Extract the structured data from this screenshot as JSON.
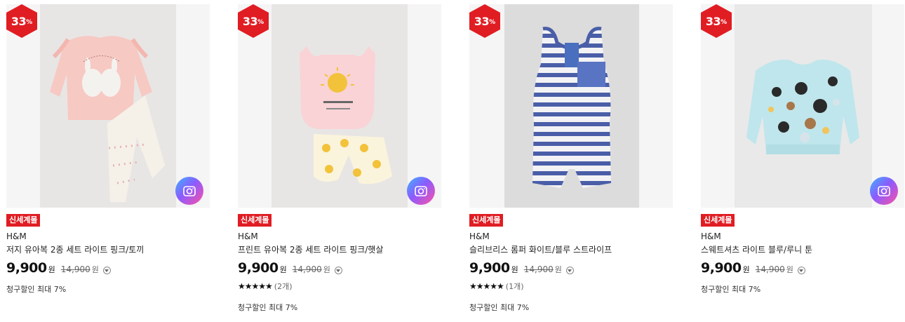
{
  "products": [
    {
      "discount": "33",
      "discount_unit": "%",
      "tag": "신세계몰",
      "brand": "H&M",
      "name": "저지 유아복 2종 세트 라이트 핑크/토끼",
      "price": "9,900",
      "price_unit": "원",
      "original_price": "14,900",
      "original_unit": "원",
      "benefit": "청구할인 최대 7%",
      "image_icon": "pink-bunny-outfit-image"
    },
    {
      "discount": "33",
      "discount_unit": "%",
      "tag": "신세계몰",
      "brand": "H&M",
      "name": "프린트 유아복 2종 세트 라이트 핑크/햇살",
      "price": "9,900",
      "price_unit": "원",
      "original_price": "14,900",
      "original_unit": "원",
      "stars": "★★★★★",
      "review_count": "(2개)",
      "benefit": "청구할인 최대 7%",
      "image_icon": "sun-print-outfit-image"
    },
    {
      "discount": "33",
      "discount_unit": "%",
      "tag": "신세계몰",
      "brand": "H&M",
      "name": "슬리브리스 롬퍼 화이트/블루 스트라이프",
      "price": "9,900",
      "price_unit": "원",
      "original_price": "14,900",
      "original_unit": "원",
      "stars": "★★★★★",
      "review_count": "(1개)",
      "benefit": "청구할인 최대 7%",
      "image_icon": "striped-romper-image"
    },
    {
      "discount": "33",
      "discount_unit": "%",
      "tag": "신세계몰",
      "brand": "H&M",
      "name": "스웨트셔츠 라이트 블루/루니 툰",
      "price": "9,900",
      "price_unit": "원",
      "original_price": "14,900",
      "original_unit": "원",
      "benefit": "청구할인 최대 7%",
      "image_icon": "looney-tunes-sweatshirt-image"
    }
  ],
  "colors": {
    "badge": "#e01d23",
    "tag": "#e01d23",
    "camera_gradient": [
      "#3cb3ff",
      "#8a5cff",
      "#ff4fa6"
    ]
  }
}
